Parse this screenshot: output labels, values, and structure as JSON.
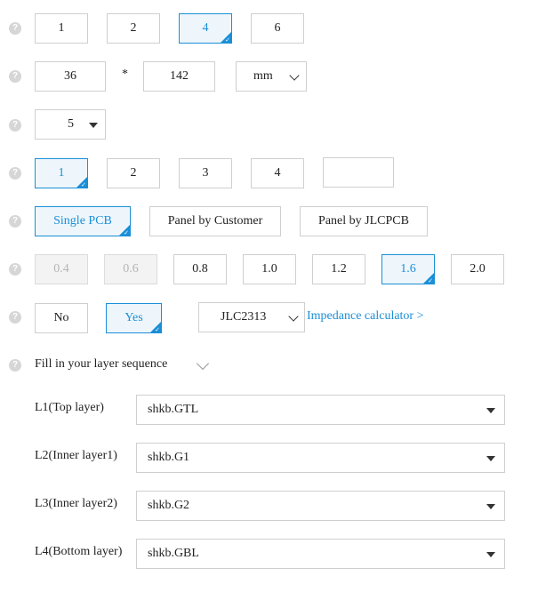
{
  "help_icon": "?",
  "layers_row": {
    "options": [
      "1",
      "2",
      "4",
      "6"
    ],
    "selected": "4"
  },
  "dimensions": {
    "width": "36",
    "separator": "*",
    "height": "142",
    "unit": "mm"
  },
  "quantity": {
    "value": "5"
  },
  "product_types_row": {
    "options": [
      "1",
      "2",
      "3",
      "4",
      ""
    ],
    "selected": "1"
  },
  "panel_row": {
    "options": [
      "Single PCB",
      "Panel by Customer",
      "Panel by JLCPCB"
    ],
    "selected": "Single PCB"
  },
  "thickness_row": {
    "options": [
      "0.4",
      "0.6",
      "0.8",
      "1.0",
      "1.2",
      "1.6",
      "2.0"
    ],
    "disabled": [
      "0.4",
      "0.6"
    ],
    "selected": "1.6"
  },
  "impedance_row": {
    "options": [
      "No",
      "Yes"
    ],
    "selected": "Yes",
    "stackup": "JLC2313",
    "calculator_link": "Impedance calculator >"
  },
  "layer_sequence": {
    "toggle_label": "Fill in your layer sequence",
    "rows": [
      {
        "label": "L1(Top layer)",
        "value": "shkb.GTL"
      },
      {
        "label": "L2(Inner layer1)",
        "value": "shkb.G1"
      },
      {
        "label": "L3(Inner layer2)",
        "value": "shkb.G2"
      },
      {
        "label": "L4(Bottom layer)",
        "value": "shkb.GBL"
      }
    ]
  },
  "colors": {
    "accent": "#1a8fd7",
    "border": "#cfcfcf",
    "disabled_bg": "#f3f3f3"
  }
}
